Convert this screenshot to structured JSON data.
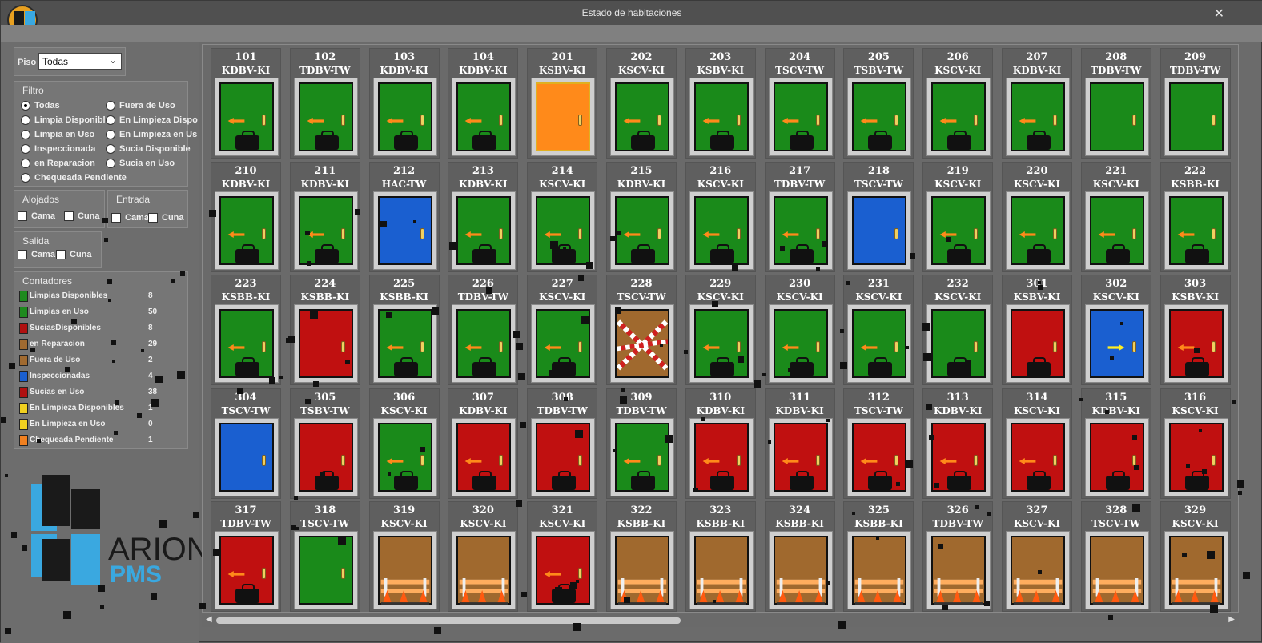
{
  "window": {
    "title": "Estado de habitaciones",
    "close_label": "✕"
  },
  "piso": {
    "label": "Piso",
    "value": "Todas"
  },
  "filtro": {
    "title": "Filtro",
    "options": [
      "Todas",
      "Limpia Disponible",
      "Limpia en Uso",
      "Inspeccionada",
      "en Reparacion",
      "Chequeada Pendiente",
      "Fuera de Uso",
      "En Limpieza Dispo",
      "En Limpieza en Us",
      "Sucia Disponible",
      "Sucia en Uso"
    ],
    "selected": "Todas"
  },
  "alojados": {
    "title": "Alojados",
    "cama": "Cama",
    "cuna": "Cuna"
  },
  "entrada": {
    "title": "Entrada",
    "cama": "Cama",
    "cuna": "Cuna"
  },
  "salida": {
    "title": "Salida",
    "cama": "Cama",
    "cuna": "Cuna"
  },
  "contadores": {
    "title": "Contadores",
    "rows": [
      {
        "label": "Limpias Disponibles",
        "value": "8",
        "color": "#1e8a1e"
      },
      {
        "label": "Limpias en Uso",
        "value": "50",
        "color": "#1e8a1e"
      },
      {
        "label": "SuciasDisponibles",
        "value": "8",
        "color": "#b01010"
      },
      {
        "label": "en Reparacion",
        "value": "29",
        "color": "#a06a30"
      },
      {
        "label": "Fuera de Uso",
        "value": "2",
        "color": "#a06a30"
      },
      {
        "label": "Inspeccionadas",
        "value": "4",
        "color": "#1a5fd0"
      },
      {
        "label": "Sucias en Uso",
        "value": "38",
        "color": "#b01010"
      },
      {
        "label": "En Limpieza Disponibles",
        "value": "1",
        "color": "#f0d020"
      },
      {
        "label": "En Limpieza en Uso",
        "value": "0",
        "color": "#f0d020"
      },
      {
        "label": "Chequeada Pendiente",
        "value": "1",
        "color": "#f08020"
      }
    ]
  },
  "logo": {
    "brand": "ARION",
    "sub": "PMS"
  },
  "colors": {
    "green": "#1a8a1a",
    "red": "#c01010",
    "blue": "#1a5fd0",
    "orange": "#ff8a1a",
    "brown": "#a0692e"
  },
  "rooms": [
    {
      "num": "101",
      "type": "KDBV-KI",
      "state": "green",
      "arrow": "left",
      "bag": true
    },
    {
      "num": "102",
      "type": "TDBV-TW",
      "state": "green",
      "arrow": "left",
      "bag": true
    },
    {
      "num": "103",
      "type": "KDBV-KI",
      "state": "green",
      "arrow": "left",
      "bag": true
    },
    {
      "num": "104",
      "type": "KDBV-KI",
      "state": "green",
      "arrow": "left",
      "bag": true
    },
    {
      "num": "201",
      "type": "KSBV-KI",
      "state": "orange",
      "arrow": "",
      "bag": false
    },
    {
      "num": "202",
      "type": "KSCV-KI",
      "state": "green",
      "arrow": "left",
      "bag": true
    },
    {
      "num": "203",
      "type": "KSBV-KI",
      "state": "green",
      "arrow": "left",
      "bag": true
    },
    {
      "num": "204",
      "type": "TSCV-TW",
      "state": "green",
      "arrow": "left",
      "bag": true
    },
    {
      "num": "205",
      "type": "TSBV-TW",
      "state": "green",
      "arrow": "left",
      "bag": true
    },
    {
      "num": "206",
      "type": "KSCV-KI",
      "state": "green",
      "arrow": "left",
      "bag": true
    },
    {
      "num": "207",
      "type": "KDBV-KI",
      "state": "green",
      "arrow": "left",
      "bag": true
    },
    {
      "num": "208",
      "type": "TDBV-TW",
      "state": "green",
      "arrow": "",
      "bag": false
    },
    {
      "num": "209",
      "type": "TDBV-TW",
      "state": "green",
      "arrow": "",
      "bag": false
    },
    {
      "num": "210",
      "type": "KDBV-KI",
      "state": "green",
      "arrow": "left",
      "bag": true
    },
    {
      "num": "211",
      "type": "KDBV-KI",
      "state": "green",
      "arrow": "left",
      "bag": true
    },
    {
      "num": "212",
      "type": "HAC-TW",
      "state": "blue",
      "arrow": "",
      "bag": false
    },
    {
      "num": "213",
      "type": "KDBV-KI",
      "state": "green",
      "arrow": "left",
      "bag": true
    },
    {
      "num": "214",
      "type": "KSCV-KI",
      "state": "green",
      "arrow": "left",
      "bag": true
    },
    {
      "num": "215",
      "type": "KDBV-KI",
      "state": "green",
      "arrow": "left",
      "bag": true
    },
    {
      "num": "216",
      "type": "KSCV-KI",
      "state": "green",
      "arrow": "left",
      "bag": true
    },
    {
      "num": "217",
      "type": "TDBV-TW",
      "state": "green",
      "arrow": "left",
      "bag": true
    },
    {
      "num": "218",
      "type": "TSCV-TW",
      "state": "blue",
      "arrow": "",
      "bag": false
    },
    {
      "num": "219",
      "type": "KSCV-KI",
      "state": "green",
      "arrow": "left",
      "bag": true
    },
    {
      "num": "220",
      "type": "KSCV-KI",
      "state": "green",
      "arrow": "left",
      "bag": true
    },
    {
      "num": "221",
      "type": "KSCV-KI",
      "state": "green",
      "arrow": "left",
      "bag": true
    },
    {
      "num": "222",
      "type": "KSBB-KI",
      "state": "green",
      "arrow": "left",
      "bag": true
    },
    {
      "num": "223",
      "type": "KSBB-KI",
      "state": "green",
      "arrow": "left",
      "bag": true
    },
    {
      "num": "224",
      "type": "KSBB-KI",
      "state": "red",
      "arrow": "",
      "bag": false
    },
    {
      "num": "225",
      "type": "KSBB-KI",
      "state": "green",
      "arrow": "left",
      "bag": true
    },
    {
      "num": "226",
      "type": "TDBV-TW",
      "state": "green",
      "arrow": "left",
      "bag": true
    },
    {
      "num": "227",
      "type": "KSCV-KI",
      "state": "green",
      "arrow": "left",
      "bag": true
    },
    {
      "num": "228",
      "type": "TSCV-TW",
      "state": "outofuse",
      "arrow": "",
      "bag": false
    },
    {
      "num": "229",
      "type": "KSCV-KI",
      "state": "green",
      "arrow": "left",
      "bag": true
    },
    {
      "num": "230",
      "type": "KSCV-KI",
      "state": "green",
      "arrow": "left",
      "bag": true
    },
    {
      "num": "231",
      "type": "KSCV-KI",
      "state": "green",
      "arrow": "left",
      "bag": true
    },
    {
      "num": "232",
      "type": "KSCV-KI",
      "state": "green",
      "arrow": "",
      "bag": true
    },
    {
      "num": "301",
      "type": "KSBV-KI",
      "state": "red",
      "arrow": "",
      "bag": true
    },
    {
      "num": "302",
      "type": "KSCV-KI",
      "state": "blue",
      "arrow": "right",
      "bag": false
    },
    {
      "num": "303",
      "type": "KSBV-KI",
      "state": "red",
      "arrow": "left",
      "bag": true
    },
    {
      "num": "304",
      "type": "TSCV-TW",
      "state": "blue",
      "arrow": "",
      "bag": false
    },
    {
      "num": "305",
      "type": "TSBV-TW",
      "state": "red",
      "arrow": "",
      "bag": true
    },
    {
      "num": "306",
      "type": "KSCV-KI",
      "state": "green",
      "arrow": "left",
      "bag": true
    },
    {
      "num": "307",
      "type": "KDBV-KI",
      "state": "red",
      "arrow": "left",
      "bag": true
    },
    {
      "num": "308",
      "type": "TDBV-TW",
      "state": "red",
      "arrow": "",
      "bag": true
    },
    {
      "num": "309",
      "type": "TDBV-TW",
      "state": "green",
      "arrow": "left",
      "bag": true
    },
    {
      "num": "310",
      "type": "KDBV-KI",
      "state": "red",
      "arrow": "left",
      "bag": true
    },
    {
      "num": "311",
      "type": "KDBV-KI",
      "state": "red",
      "arrow": "left",
      "bag": true
    },
    {
      "num": "312",
      "type": "TSCV-TW",
      "state": "red",
      "arrow": "left",
      "bag": true
    },
    {
      "num": "313",
      "type": "KDBV-KI",
      "state": "red",
      "arrow": "left",
      "bag": true
    },
    {
      "num": "314",
      "type": "KSCV-KI",
      "state": "red",
      "arrow": "left",
      "bag": true
    },
    {
      "num": "315",
      "type": "KDBV-KI",
      "state": "red",
      "arrow": "",
      "bag": true
    },
    {
      "num": "316",
      "type": "KSCV-KI",
      "state": "red",
      "arrow": "",
      "bag": true
    },
    {
      "num": "317",
      "type": "TDBV-TW",
      "state": "red",
      "arrow": "left",
      "bag": true
    },
    {
      "num": "318",
      "type": "TSCV-TW",
      "state": "green",
      "arrow": "",
      "bag": false
    },
    {
      "num": "319",
      "type": "KSCV-KI",
      "state": "repair",
      "arrow": "",
      "bag": false
    },
    {
      "num": "320",
      "type": "KSCV-KI",
      "state": "repair",
      "arrow": "",
      "bag": false
    },
    {
      "num": "321",
      "type": "KSCV-KI",
      "state": "red",
      "arrow": "left",
      "bag": true
    },
    {
      "num": "322",
      "type": "KSBB-KI",
      "state": "repair",
      "arrow": "",
      "bag": false
    },
    {
      "num": "323",
      "type": "KSBB-KI",
      "state": "repair",
      "arrow": "",
      "bag": false
    },
    {
      "num": "324",
      "type": "KSBB-KI",
      "state": "repair",
      "arrow": "",
      "bag": false
    },
    {
      "num": "325",
      "type": "KSBB-KI",
      "state": "repair",
      "arrow": "",
      "bag": false
    },
    {
      "num": "326",
      "type": "TDBV-TW",
      "state": "repair",
      "arrow": "",
      "bag": false
    },
    {
      "num": "327",
      "type": "KSCV-KI",
      "state": "repair",
      "arrow": "",
      "bag": false
    },
    {
      "num": "328",
      "type": "TSCV-TW",
      "state": "repair",
      "arrow": "",
      "bag": false
    },
    {
      "num": "329",
      "type": "KSCV-KI",
      "state": "repair",
      "arrow": "",
      "bag": false
    }
  ]
}
